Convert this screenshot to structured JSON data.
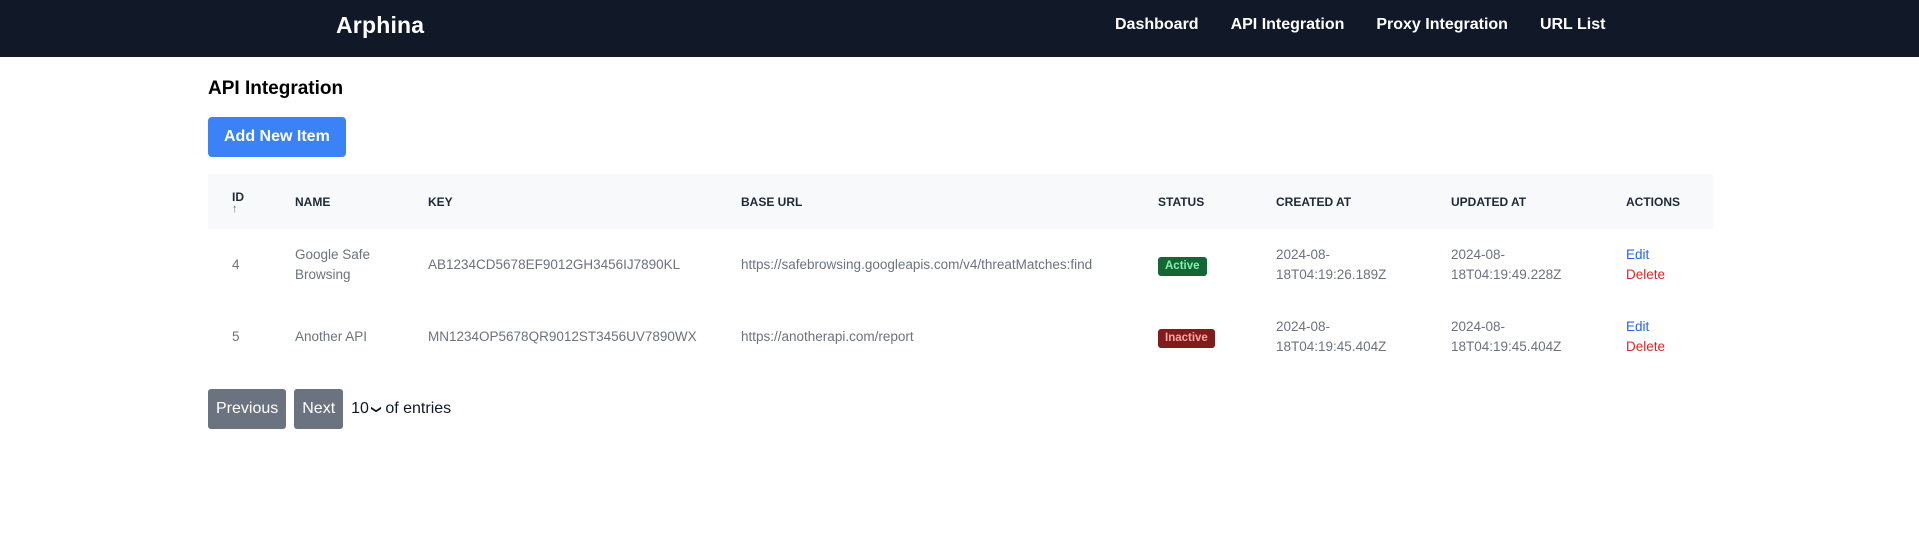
{
  "navbar": {
    "brand": "Arphina",
    "links": [
      "Dashboard",
      "API Integration",
      "Proxy Integration",
      "URL List"
    ]
  },
  "page": {
    "title": "API Integration",
    "add_button": "Add New Item"
  },
  "table": {
    "columns": [
      "ID",
      "NAME",
      "KEY",
      "BASE URL",
      "STATUS",
      "CREATED AT",
      "UPDATED AT",
      "ACTIONS"
    ],
    "sort_indicator": "↑",
    "rows": [
      {
        "id": "4",
        "name": "Google Safe Browsing",
        "key": "AB1234CD5678EF9012GH3456IJ7890KL",
        "base_url": "https://safebrowsing.googleapis.com/v4/threatMatches:find",
        "status": "Active",
        "created_at": "2024-08-18T04:19:26.189Z",
        "updated_at": "2024-08-18T04:19:49.228Z",
        "edit": "Edit",
        "delete": "Delete"
      },
      {
        "id": "5",
        "name": "Another API",
        "key": "MN1234OP5678QR9012ST3456UV7890WX",
        "base_url": "https://anotherapi.com/report",
        "status": "Inactive",
        "created_at": "2024-08-18T04:19:45.404Z",
        "updated_at": "2024-08-18T04:19:45.404Z",
        "edit": "Edit",
        "delete": "Delete"
      }
    ]
  },
  "pagination": {
    "previous": "Previous",
    "next": "Next",
    "per_page": "10",
    "suffix": "of entries"
  },
  "colors": {
    "navbar_bg": "#111827",
    "primary": "#3b82f6",
    "active_badge": "#166534",
    "inactive_badge": "#7f1d1d",
    "edit_link": "#2563eb",
    "delete_link": "#dc2626"
  }
}
